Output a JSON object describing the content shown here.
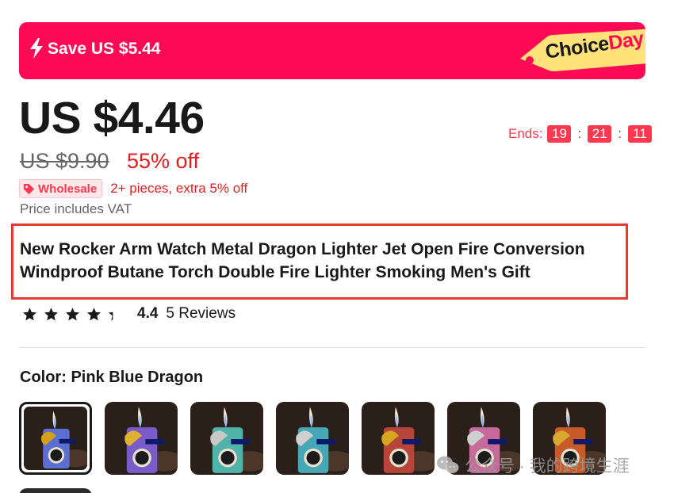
{
  "banner": {
    "save_text": "Save US $5.44",
    "choice_text": "Choice",
    "day_text": "Day",
    "bg_color": "#fd0a54",
    "tag_color": "#ffe27a"
  },
  "price": {
    "current": "US $4.46",
    "original": "US $9.90",
    "discount": "55% off"
  },
  "countdown": {
    "label": "Ends:",
    "hours": "19",
    "minutes": "21",
    "seconds": "11"
  },
  "wholesale": {
    "badge": "Wholesale",
    "text": "2+ pieces, extra 5% off"
  },
  "vat_note": "Price includes VAT",
  "product_title": "New Rocker Arm Watch Metal Dragon Lighter Jet Open Fire Conversion Windproof Butane Torch Double Fire Lighter Smoking Men's Gift",
  "rating": {
    "score": "4.4",
    "reviews": "5 Reviews",
    "stars_value": 4.4
  },
  "color": {
    "label": "Color:",
    "selected": "Pink Blue Dragon",
    "options": [
      {
        "name": "Pink Blue Dragon",
        "body": "#5b6fd1",
        "dragon": "#d4a017"
      },
      {
        "name": "Purple Gold Dragon",
        "body": "#7a5cc8",
        "dragon": "#e0b030"
      },
      {
        "name": "Green Silver Dragon",
        "body": "#4fb3a9",
        "dragon": "#c8c8c8"
      },
      {
        "name": "Teal Silver Dragon",
        "body": "#47a8b5",
        "dragon": "#d0d0d0"
      },
      {
        "name": "Red Gold Dragon",
        "body": "#b8453a",
        "dragon": "#d9a520"
      },
      {
        "name": "Pink Silver Dragon",
        "body": "#c56a9a",
        "dragon": "#cfcfcf"
      },
      {
        "name": "Orange Gold Dragon",
        "body": "#c85a2a",
        "dragon": "#d8a830"
      }
    ]
  },
  "watermark": "公众号 · 我的跨境生涯"
}
